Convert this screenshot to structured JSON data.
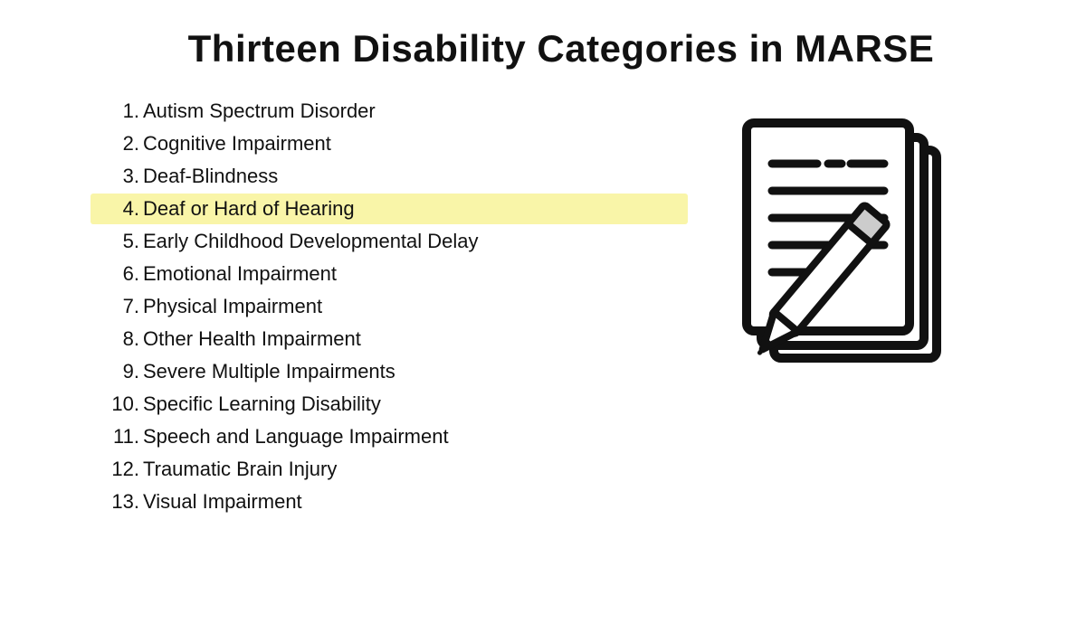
{
  "page": {
    "title": "Thirteen Disability Categories in MARSE",
    "backgroundColor": "#ffffff"
  },
  "list": {
    "items": [
      {
        "number": "1.",
        "text": "Autism Spectrum Disorder",
        "highlighted": false
      },
      {
        "number": "2.",
        "text": "Cognitive Impairment",
        "highlighted": false
      },
      {
        "number": "3.",
        "text": "Deaf-Blindness",
        "highlighted": false
      },
      {
        "number": "4.",
        "text": "Deaf or Hard of Hearing",
        "highlighted": true
      },
      {
        "number": "5.",
        "text": "Early Childhood Developmental Delay",
        "highlighted": false
      },
      {
        "number": "6.",
        "text": "Emotional Impairment",
        "highlighted": false
      },
      {
        "number": "7.",
        "text": "Physical Impairment",
        "highlighted": false
      },
      {
        "number": "8.",
        "text": "Other Health Impairment",
        "highlighted": false
      },
      {
        "number": "9.",
        "text": "Severe Multiple Impairments",
        "highlighted": false
      },
      {
        "number": "10.",
        "text": "Specific Learning Disability",
        "highlighted": false
      },
      {
        "number": "11.",
        "text": "Speech and Language Impairment",
        "highlighted": false
      },
      {
        "number": "12.",
        "text": "Traumatic Brain Injury",
        "highlighted": false
      },
      {
        "number": "13.",
        "text": "Visual Impairment",
        "highlighted": false
      }
    ]
  }
}
